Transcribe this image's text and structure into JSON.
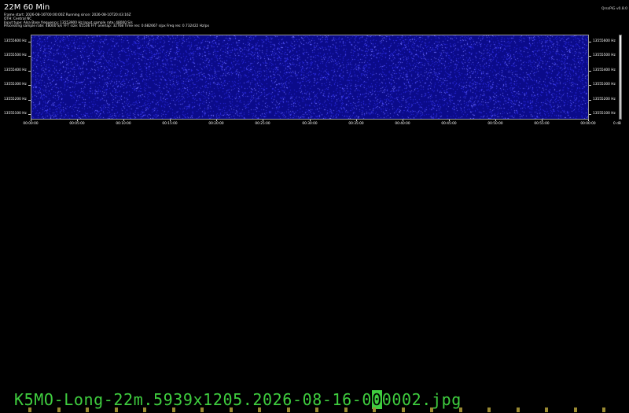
{
  "header": {
    "title": "22M 60 Min",
    "version": "QrssPiG v0.8.0",
    "info_lines": [
      "Frame start: 2026-08-16T00:00:00Z Running since: 2026-08-10T20:43:16Z",
      "QTH: Central NC",
      "Input type: Alsa Base frequency: 13553900 Hz Input sample rate: 48000 S/s",
      "Processing sample rate: 48000 S/s FFT size: 65536 FFT overlap: 32768 Time res: 0.682667 s/px Freq res: 0.732422 Hz/px"
    ]
  },
  "waterfall": {
    "colors": {
      "background": "#0b0b8a",
      "noise_a": "#2a2ae0",
      "noise_b": "#6a6aff"
    },
    "freq_labels": [
      "13555600 Hz",
      "13555500 Hz",
      "13555400 Hz",
      "13555300 Hz",
      "13555200 Hz",
      "13555100 Hz"
    ],
    "time_labels": [
      "00:00:00",
      "00:05:00",
      "00:10:00",
      "00:15:00",
      "00:20:00",
      "00:25:00",
      "00:30:00",
      "00:35:00",
      "00:40:00",
      "00:45:00",
      "00:50:00",
      "00:55:00",
      "00:00:00"
    ],
    "scale_label": "0 dB"
  },
  "footer": {
    "filename_pre": "K5MO-Long-22m.5939x1205.2026-08-16-0",
    "filename_cursor": "0",
    "filename_post": "0002.jpg",
    "color": "#3fce3f"
  }
}
